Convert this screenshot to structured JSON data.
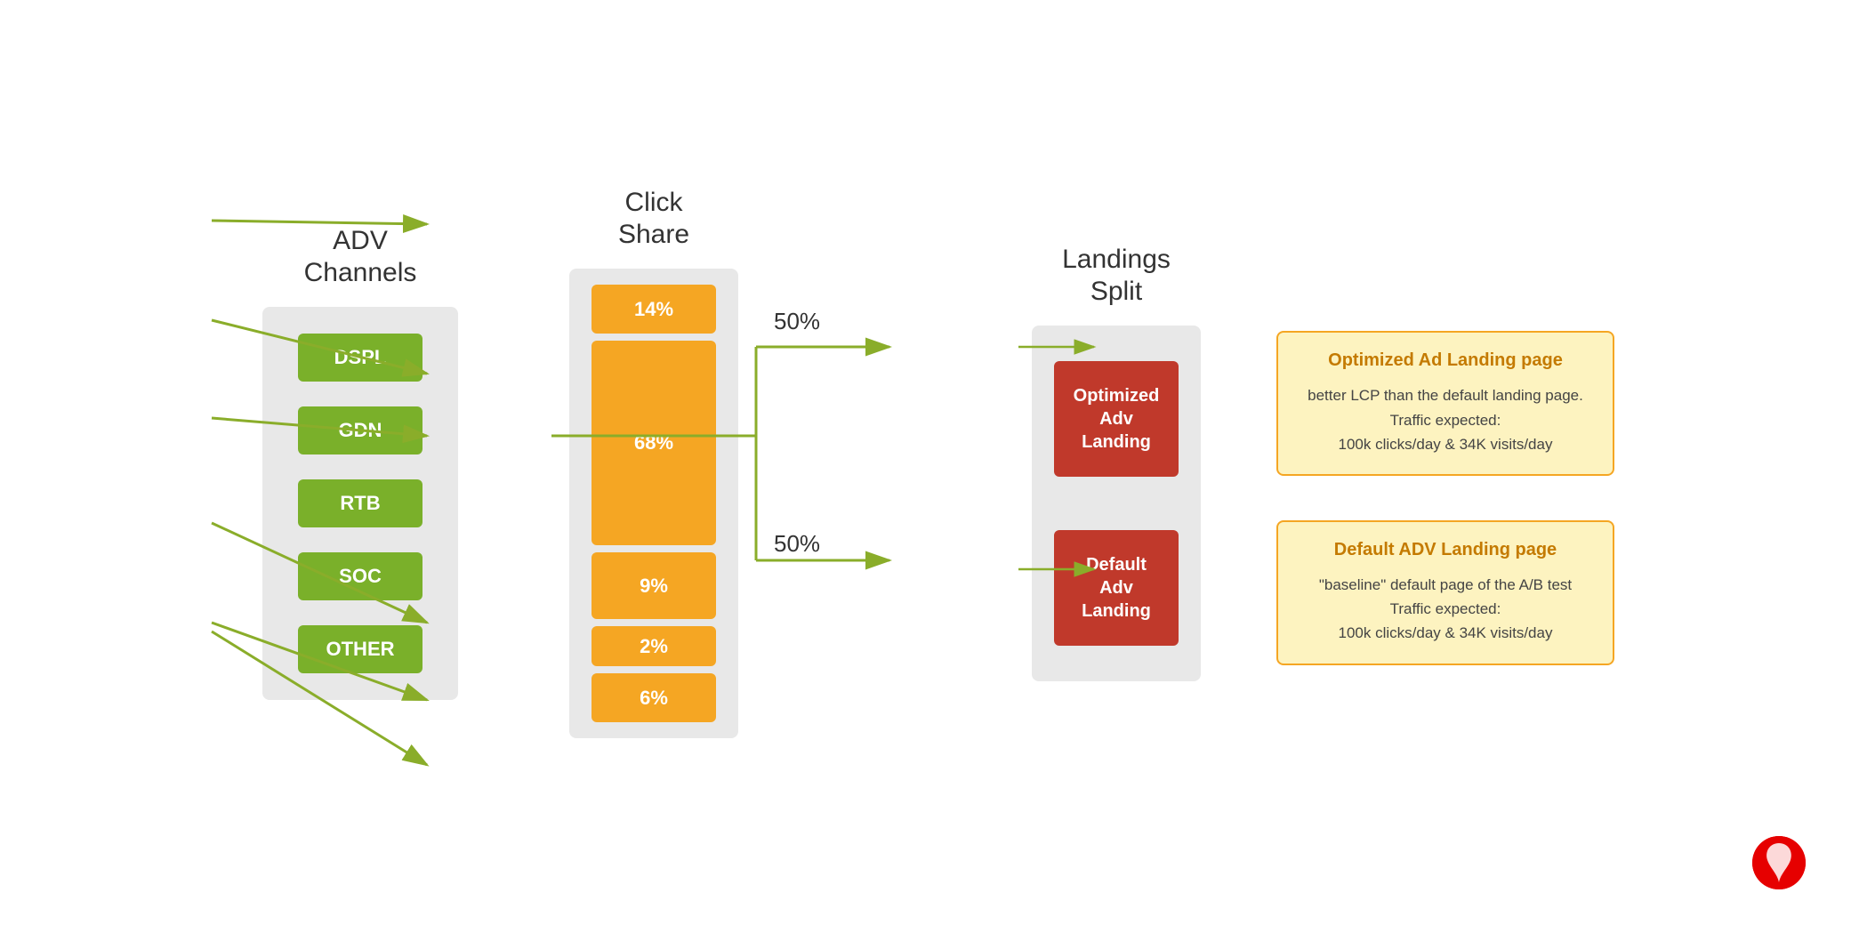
{
  "headers": {
    "adv": "ADV\nChannels",
    "click": "Click\nShare",
    "landings": "Landings\nSplit"
  },
  "channels": [
    {
      "label": "DSPL"
    },
    {
      "label": "GDN"
    },
    {
      "label": "RTB"
    },
    {
      "label": "SOC"
    },
    {
      "label": "OTHER"
    }
  ],
  "clickShares": [
    {
      "label": "14%",
      "size": "small"
    },
    {
      "label": "68%",
      "size": "large"
    },
    {
      "label": "9%",
      "size": "medium"
    },
    {
      "label": "2%",
      "size": "tiny"
    },
    {
      "label": "6%",
      "size": "mini"
    }
  ],
  "landings": [
    {
      "label": "Optimized\nAdv\nLanding"
    },
    {
      "label": "Default\nAdv\nLanding"
    }
  ],
  "splits": [
    {
      "label": "50%"
    },
    {
      "label": "50%"
    }
  ],
  "infoCards": [
    {
      "title": "Optimized Ad Landing page",
      "body": "better LCP than the default landing page.\nTraffic expected:\n100k clicks/day  & 34K visits/day"
    },
    {
      "title": "Default ADV Landing page",
      "body": "\"baseline\" default page of the A/B test\nTraffic expected:\n100k clicks/day  & 34K visits/day"
    }
  ],
  "colors": {
    "green": "#7ab02a",
    "orange": "#f5a623",
    "red": "#c0392b",
    "infoCardBg": "#fdf3c0",
    "infoCardBorder": "#f5a623",
    "infoCardTitle": "#c47a00",
    "colBg": "#e8e8e8",
    "arrow": "#8aad2a",
    "vodafone": "#e60000"
  }
}
